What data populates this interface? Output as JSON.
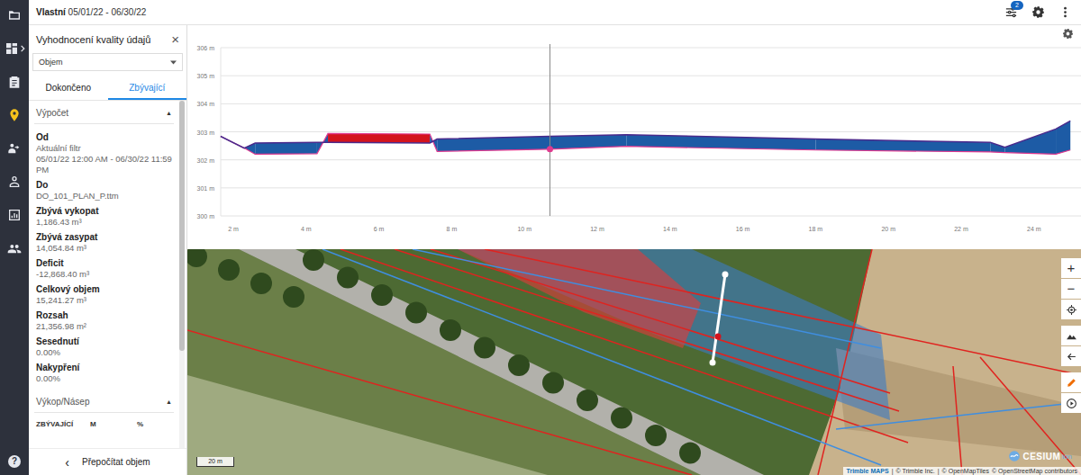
{
  "topbar": {
    "title": "Vlastní",
    "range": "05/01/22 - 06/30/22",
    "badge": "2"
  },
  "nav": [
    {
      "selected": false
    },
    {
      "selected": false
    },
    {
      "selected": false
    },
    {
      "selected": true
    },
    {
      "selected": false
    },
    {
      "selected": false
    },
    {
      "selected": false
    },
    {
      "selected": false
    }
  ],
  "help": "?",
  "panel": {
    "title": "Vyhodnocení kvality údajů",
    "close": "×",
    "dropdown": "Objem",
    "tabs": [
      {
        "label": "Dokončeno",
        "selected": false
      },
      {
        "label": "Zbývající",
        "selected": true
      }
    ],
    "calculation": {
      "title": "Výpočet",
      "toggle": "▲",
      "expanded": true,
      "fields": [
        {
          "label": "Od",
          "values": [
            "Aktuální filtr",
            "05/01/22 12:00 AM - 06/30/22 11:59 PM"
          ]
        },
        {
          "label": "Do",
          "values": [
            "DO_101_PLAN_P.ttm"
          ]
        },
        {
          "label": "Zbývá vykopat",
          "values": [
            "1,186.43 m³"
          ]
        },
        {
          "label": "Zbývá zasypat",
          "values": [
            "14,054.84 m³"
          ]
        },
        {
          "label": "Deficit",
          "values": [
            "-12,868.40 m³"
          ]
        },
        {
          "label": "Celkový objem",
          "values": [
            "15,241.27 m³"
          ]
        },
        {
          "label": "Rozsah",
          "values": [
            "21,356.98 m²"
          ]
        },
        {
          "label": "Sesednutí",
          "values": [
            "0.00%"
          ]
        },
        {
          "label": "Nakypření",
          "values": [
            "0.00%"
          ]
        }
      ]
    },
    "cut_fill": {
      "title": "Výkop/Násep",
      "toggle": "▲",
      "expanded": true,
      "columns": [
        "ZBÝVAJÍCÍ",
        "M",
        "%"
      ]
    },
    "scrollbar": {
      "level": 0.72
    },
    "footer": {
      "chevron": "‹",
      "label": "Přepočítat objem"
    }
  },
  "chart": {
    "y_ticks": [
      "306 m",
      "305 m",
      "304 m",
      "303 m",
      "302 m",
      "301 m",
      "300 m"
    ],
    "y_values": [
      306,
      305,
      304,
      303,
      302,
      301,
      300
    ],
    "x_ticks": [
      "2 m",
      "4 m",
      "6 m",
      "8 m",
      "10 m",
      "12 m",
      "14 m",
      "16 m",
      "18 m",
      "20 m",
      "22 m",
      "24 m"
    ],
    "x_values": [
      2,
      4,
      6,
      8,
      10,
      12,
      14,
      16,
      18,
      20,
      22,
      24
    ],
    "x": [
      1.65,
      2.3,
      2.6,
      4.3,
      4.6,
      7.4,
      7.6,
      10.7,
      12.8,
      18,
      22.8,
      23.2,
      24.6,
      25
    ],
    "design": [
      302.84,
      302.42,
      302.6,
      302.62,
      302.62,
      302.6,
      302.74,
      302.84,
      302.9,
      302.74,
      302.62,
      302.45,
      303.1,
      303.39
    ],
    "ground": [
      302.84,
      302.42,
      302.2,
      302.22,
      302.94,
      302.92,
      302.3,
      302.38,
      302.48,
      302.35,
      302.28,
      302.26,
      302.2,
      302.35
    ],
    "cursor": 10.7
  },
  "map": {
    "zoom_in": "+",
    "zoom_out": "−",
    "scale": "20 m",
    "logo": "CESIUM",
    "logo_suffix": "ion",
    "attribution": [
      "Trimble MAPS",
      "|",
      "© Trimble Inc.",
      "|",
      "© OpenMapTiles",
      "© OpenStreetMap contributors"
    ]
  }
}
